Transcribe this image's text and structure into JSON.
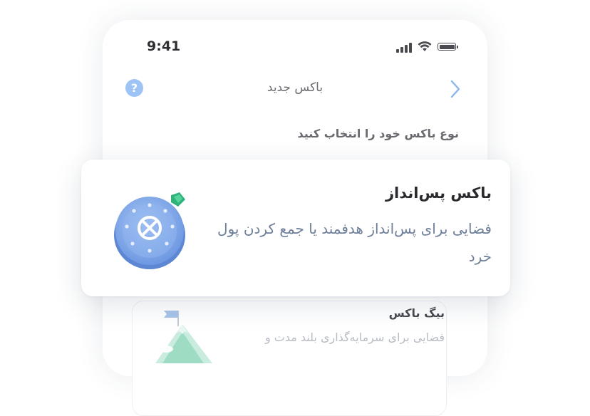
{
  "status_bar": {
    "time": "9:41"
  },
  "nav": {
    "title": "باکس جدید",
    "help_glyph": "?"
  },
  "prompt": "نوع باکس خود را انتخاب کنید",
  "options": [
    {
      "title": "باکس پس‌انداز",
      "description": "فضایی برای پس‌انداز هدفمند یا جمع کردن پول خرد",
      "icon": "safe-icon",
      "accent": "#6f9be8"
    },
    {
      "title": "بیگ باکس",
      "description": "فضایی برای سرمایه‌گذاری بلند مدت و",
      "icon": "mountain-flag-icon",
      "accent": "#7fd3b0"
    }
  ],
  "colors": {
    "help": "#9ec3f5",
    "chevron": "#8db6ef",
    "description": "#6e7f9a"
  }
}
